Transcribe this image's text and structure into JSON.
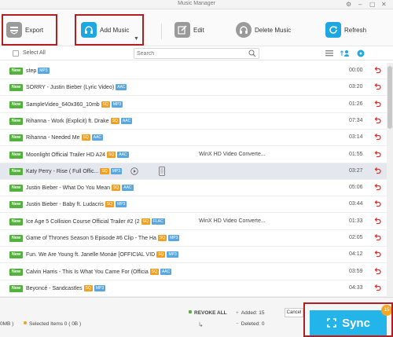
{
  "window": {
    "title": "Music Manager"
  },
  "toolbar": {
    "export_label": "Export",
    "add_music_label": "Add Music",
    "edit_label": "Edit",
    "delete_label": "Delete Music",
    "refresh_label": "Refresh"
  },
  "list_controls": {
    "select_all_label": "Select All",
    "search_placeholder": "Search"
  },
  "songs": [
    {
      "badge": "New",
      "title": "step",
      "tags": [
        {
          "kind": "fmt",
          "text": "MP3"
        }
      ],
      "extra": "",
      "duration": "00:00"
    },
    {
      "badge": "New",
      "title": "SORRY - Justin Bieber (Lyric Video)",
      "tags": [
        {
          "kind": "fmt",
          "text": "AAC"
        }
      ],
      "extra": "",
      "duration": "03:20"
    },
    {
      "badge": "New",
      "title": "SampleVideo_640x360_10mb",
      "tags": [
        {
          "kind": "sq",
          "text": "SQ"
        },
        {
          "kind": "fmt",
          "text": "MP3"
        }
      ],
      "extra": "",
      "duration": "01:26"
    },
    {
      "badge": "New",
      "title": "Rihanna - Work (Explicit) ft. Drake",
      "tags": [
        {
          "kind": "sq",
          "text": "SQ"
        },
        {
          "kind": "fmt",
          "text": "AAC"
        }
      ],
      "extra": "",
      "duration": "07:34"
    },
    {
      "badge": "New",
      "title": "Rihanna - Needed Me",
      "tags": [
        {
          "kind": "sq",
          "text": "SQ"
        },
        {
          "kind": "fmt",
          "text": "AAC"
        }
      ],
      "extra": "",
      "duration": "03:14"
    },
    {
      "badge": "New",
      "title": "Moonlight  Official Trailer HD   A24",
      "tags": [
        {
          "kind": "sq",
          "text": "SQ"
        },
        {
          "kind": "fmt",
          "text": "AAC"
        }
      ],
      "extra": "WinX HD Video Converte...",
      "duration": "01:55"
    },
    {
      "badge": "New",
      "title": "Katy Perry - Rise ( Full Offic...",
      "tags": [
        {
          "kind": "sq",
          "text": "SQ"
        },
        {
          "kind": "fmt",
          "text": "MP3"
        }
      ],
      "extra": "",
      "duration": "03:27",
      "selected": true
    },
    {
      "badge": "New",
      "title": "Justin Bieber - What Do You Mean",
      "tags": [
        {
          "kind": "sq",
          "text": "SQ"
        },
        {
          "kind": "fmt",
          "text": "AAC"
        }
      ],
      "extra": "",
      "duration": "05:06"
    },
    {
      "badge": "New",
      "title": "Justin Bieber - Baby ft. Ludacris",
      "tags": [
        {
          "kind": "sq",
          "text": "SQ"
        },
        {
          "kind": "fmt",
          "text": "MP3"
        }
      ],
      "extra": "",
      "duration": "03:44"
    },
    {
      "badge": "New",
      "title": "Ice Age 5  Collision Course Official Trailer #2 (2",
      "tags": [
        {
          "kind": "sq",
          "text": "SQ"
        },
        {
          "kind": "fmt",
          "text": "FLAC"
        }
      ],
      "extra": "WinX HD Video Converte...",
      "duration": "01:33"
    },
    {
      "badge": "New",
      "title": "Game of Thrones Season 5  Episode #6 Clip - The Ha",
      "tags": [
        {
          "kind": "sq",
          "text": "SQ"
        },
        {
          "kind": "fmt",
          "text": "MP3"
        }
      ],
      "extra": "",
      "duration": "02:05"
    },
    {
      "badge": "New",
      "title": "Fun.  We Are Young ft. Janelle Monáe [OFFICIAL VID",
      "tags": [
        {
          "kind": "sq",
          "text": "SQ"
        },
        {
          "kind": "fmt",
          "text": "MP3"
        }
      ],
      "extra": "",
      "duration": "04:12"
    },
    {
      "badge": "New",
      "title": "Calvin Harris - This Is What You Came For (Officia",
      "tags": [
        {
          "kind": "sq",
          "text": "SQ"
        },
        {
          "kind": "fmt",
          "text": "AAC"
        }
      ],
      "extra": "",
      "duration": "03:59"
    },
    {
      "badge": "New",
      "title": "Beyoncé - Sandcastles",
      "tags": [
        {
          "kind": "sq",
          "text": "SQ"
        },
        {
          "kind": "fmt",
          "text": "MP3"
        }
      ],
      "extra": "",
      "duration": "04:33"
    }
  ],
  "footer": {
    "size_fragment": "0MB )",
    "selected_items": "Selected Items 0 ( 0B )",
    "revoke_all": "REVOKE ALL",
    "added": "Added: 15",
    "deleted": "Deleted: 0",
    "cancel_label": "Cancel",
    "sync_label": "Sync",
    "sync_badge": "15"
  },
  "colors": {
    "accent": "#1ea7e1",
    "new_badge": "#55b13e",
    "sq_tag": "#f0a020",
    "format_tag": "#5aa7e0",
    "undo_icon": "#e0302a",
    "highlight_box": "#b02020",
    "sync_button": "#23b5ea",
    "sync_badge": "#f5a623"
  },
  "icons": {
    "export": "export-icon",
    "add_music": "headphones-plus-icon",
    "edit": "edit-icon",
    "delete": "headphones-minus-icon",
    "refresh": "refresh-icon",
    "row_action": "undo-icon",
    "sync": "sync-icon"
  }
}
